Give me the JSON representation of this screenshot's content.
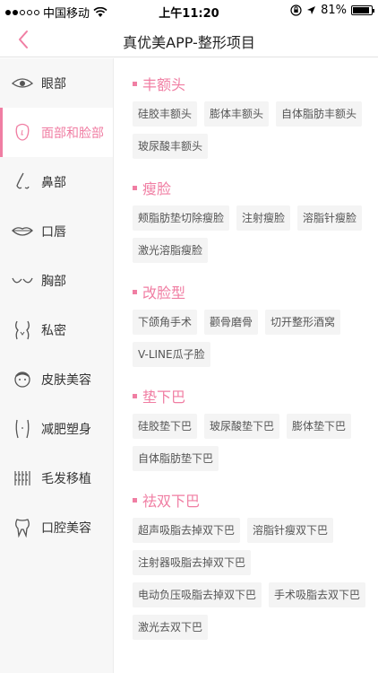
{
  "status_bar": {
    "carrier": "中国移动",
    "time": "上午11:20",
    "battery": "81%"
  },
  "nav": {
    "title": "真优美APP-整形项目"
  },
  "sidebar": {
    "items": [
      {
        "label": "眼部",
        "icon": "eye-icon"
      },
      {
        "label": "面部和脸部",
        "icon": "face-icon",
        "active": true
      },
      {
        "label": "鼻部",
        "icon": "nose-icon"
      },
      {
        "label": "口唇",
        "icon": "lips-icon"
      },
      {
        "label": "胸部",
        "icon": "chest-icon"
      },
      {
        "label": "私密",
        "icon": "private-icon"
      },
      {
        "label": "皮肤美容",
        "icon": "skin-icon"
      },
      {
        "label": "减肥塑身",
        "icon": "body-icon"
      },
      {
        "label": "毛发移植",
        "icon": "hair-icon"
      },
      {
        "label": "口腔美容",
        "icon": "tooth-icon"
      }
    ]
  },
  "colors": {
    "accent": "#f07ea3"
  },
  "sections": [
    {
      "title": "丰额头",
      "items": [
        "硅胶丰额头",
        "膨体丰额头",
        "自体脂肪丰额头",
        "玻尿酸丰额头"
      ]
    },
    {
      "title": "瘦脸",
      "items": [
        "颊脂肪垫切除瘦脸",
        "注射瘦脸",
        "溶脂针瘦脸",
        "激光溶脂瘦脸"
      ]
    },
    {
      "title": "改脸型",
      "items": [
        "下颌角手术",
        "颧骨磨骨",
        "切开整形酒窝",
        "V-LINE瓜子脸"
      ]
    },
    {
      "title": "垫下巴",
      "items": [
        "硅胶垫下巴",
        "玻尿酸垫下巴",
        "膨体垫下巴",
        "自体脂肪垫下巴"
      ]
    },
    {
      "title": "祛双下巴",
      "items": [
        "超声吸脂去掉双下巴",
        "溶脂针瘦双下巴",
        "注射器吸脂去掉双下巴",
        "电动负压吸脂去掉双下巴",
        "手术吸脂去双下巴",
        "激光去双下巴"
      ]
    }
  ]
}
